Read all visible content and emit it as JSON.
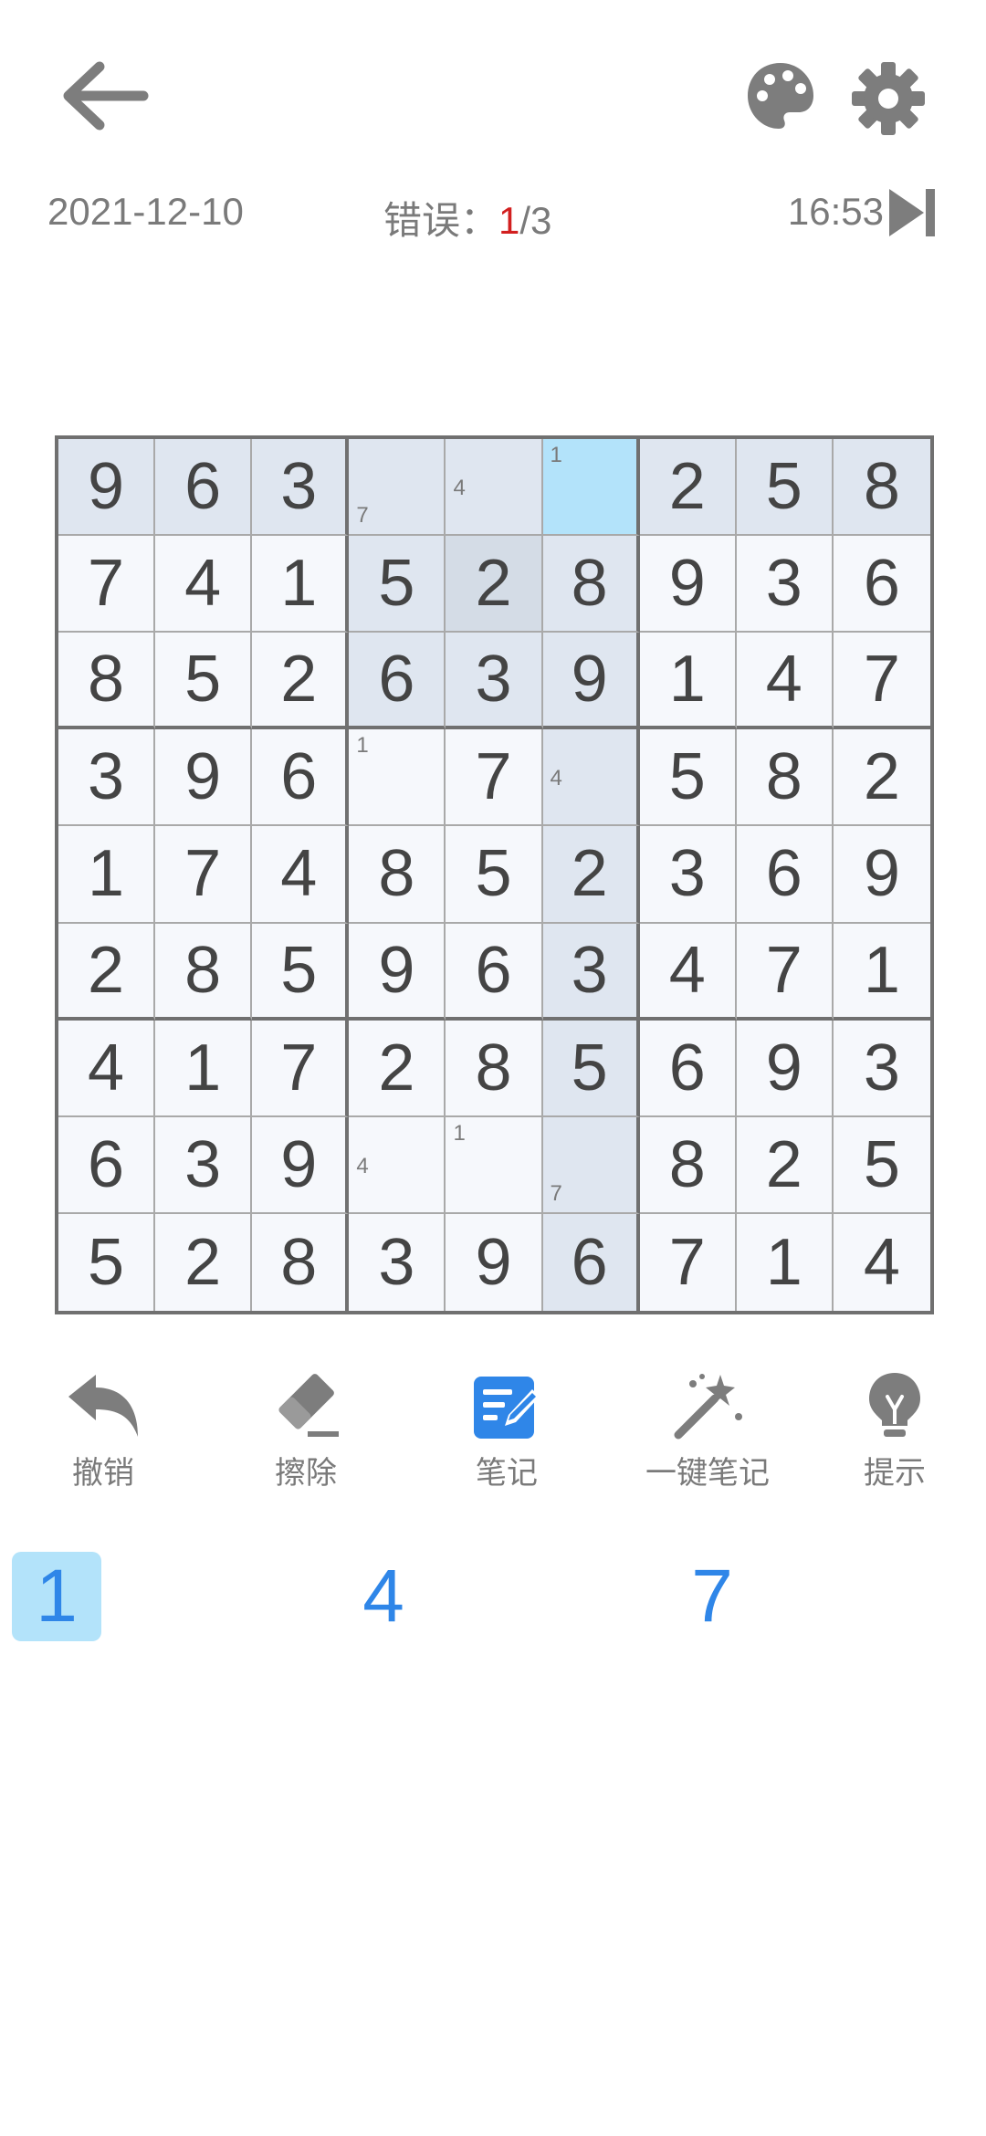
{
  "header": {
    "date": "2021-12-10",
    "errors_label": "错误：",
    "errors_count": "1",
    "errors_max": "/3",
    "timer": "16:53",
    "icons": {
      "back": "back-arrow-icon",
      "palette": "palette-icon",
      "settings": "gear-icon",
      "pause": "skip-next-icon"
    }
  },
  "board": {
    "rows": [
      [
        "9",
        "6",
        "3",
        "",
        "",
        "",
        "2",
        "5",
        "8"
      ],
      [
        "7",
        "4",
        "1",
        "5",
        "2",
        "8",
        "9",
        "3",
        "6"
      ],
      [
        "8",
        "5",
        "2",
        "6",
        "3",
        "9",
        "1",
        "4",
        "7"
      ],
      [
        "3",
        "9",
        "6",
        "",
        "7",
        "",
        "5",
        "8",
        "2"
      ],
      [
        "1",
        "7",
        "4",
        "8",
        "5",
        "2",
        "3",
        "6",
        "9"
      ],
      [
        "2",
        "8",
        "5",
        "9",
        "6",
        "3",
        "4",
        "7",
        "1"
      ],
      [
        "4",
        "1",
        "7",
        "2",
        "8",
        "5",
        "6",
        "9",
        "3"
      ],
      [
        "6",
        "3",
        "9",
        "",
        "",
        "",
        "8",
        "2",
        "5"
      ],
      [
        "5",
        "2",
        "8",
        "3",
        "9",
        "6",
        "7",
        "1",
        "4"
      ]
    ],
    "notes": {
      "0,3": [
        "7"
      ],
      "0,4": [
        "4"
      ],
      "0,5": [
        "1"
      ],
      "3,3": [
        "1"
      ],
      "3,5": [
        "4"
      ],
      "7,3": [
        "4"
      ],
      "7,4": [
        "1"
      ],
      "7,5": [
        "7"
      ]
    },
    "selected_cell": "0,5",
    "colors": {
      "selected": "#b3e3fa",
      "highlight": "#dfe6f0",
      "same_box": "#d4dce6",
      "digit": "#444444",
      "note": "#7a7a7a",
      "error": "#d21f1f"
    }
  },
  "toolbar": {
    "undo_label": "撤销",
    "erase_label": "擦除",
    "notes_label": "笔记",
    "auto_notes_label": "一键笔记",
    "hint_label": "提示",
    "active_tool": "notes",
    "accent": "#2f86e8"
  },
  "numpad": {
    "keys": [
      "1",
      "4",
      "7"
    ],
    "active_key": "1"
  }
}
